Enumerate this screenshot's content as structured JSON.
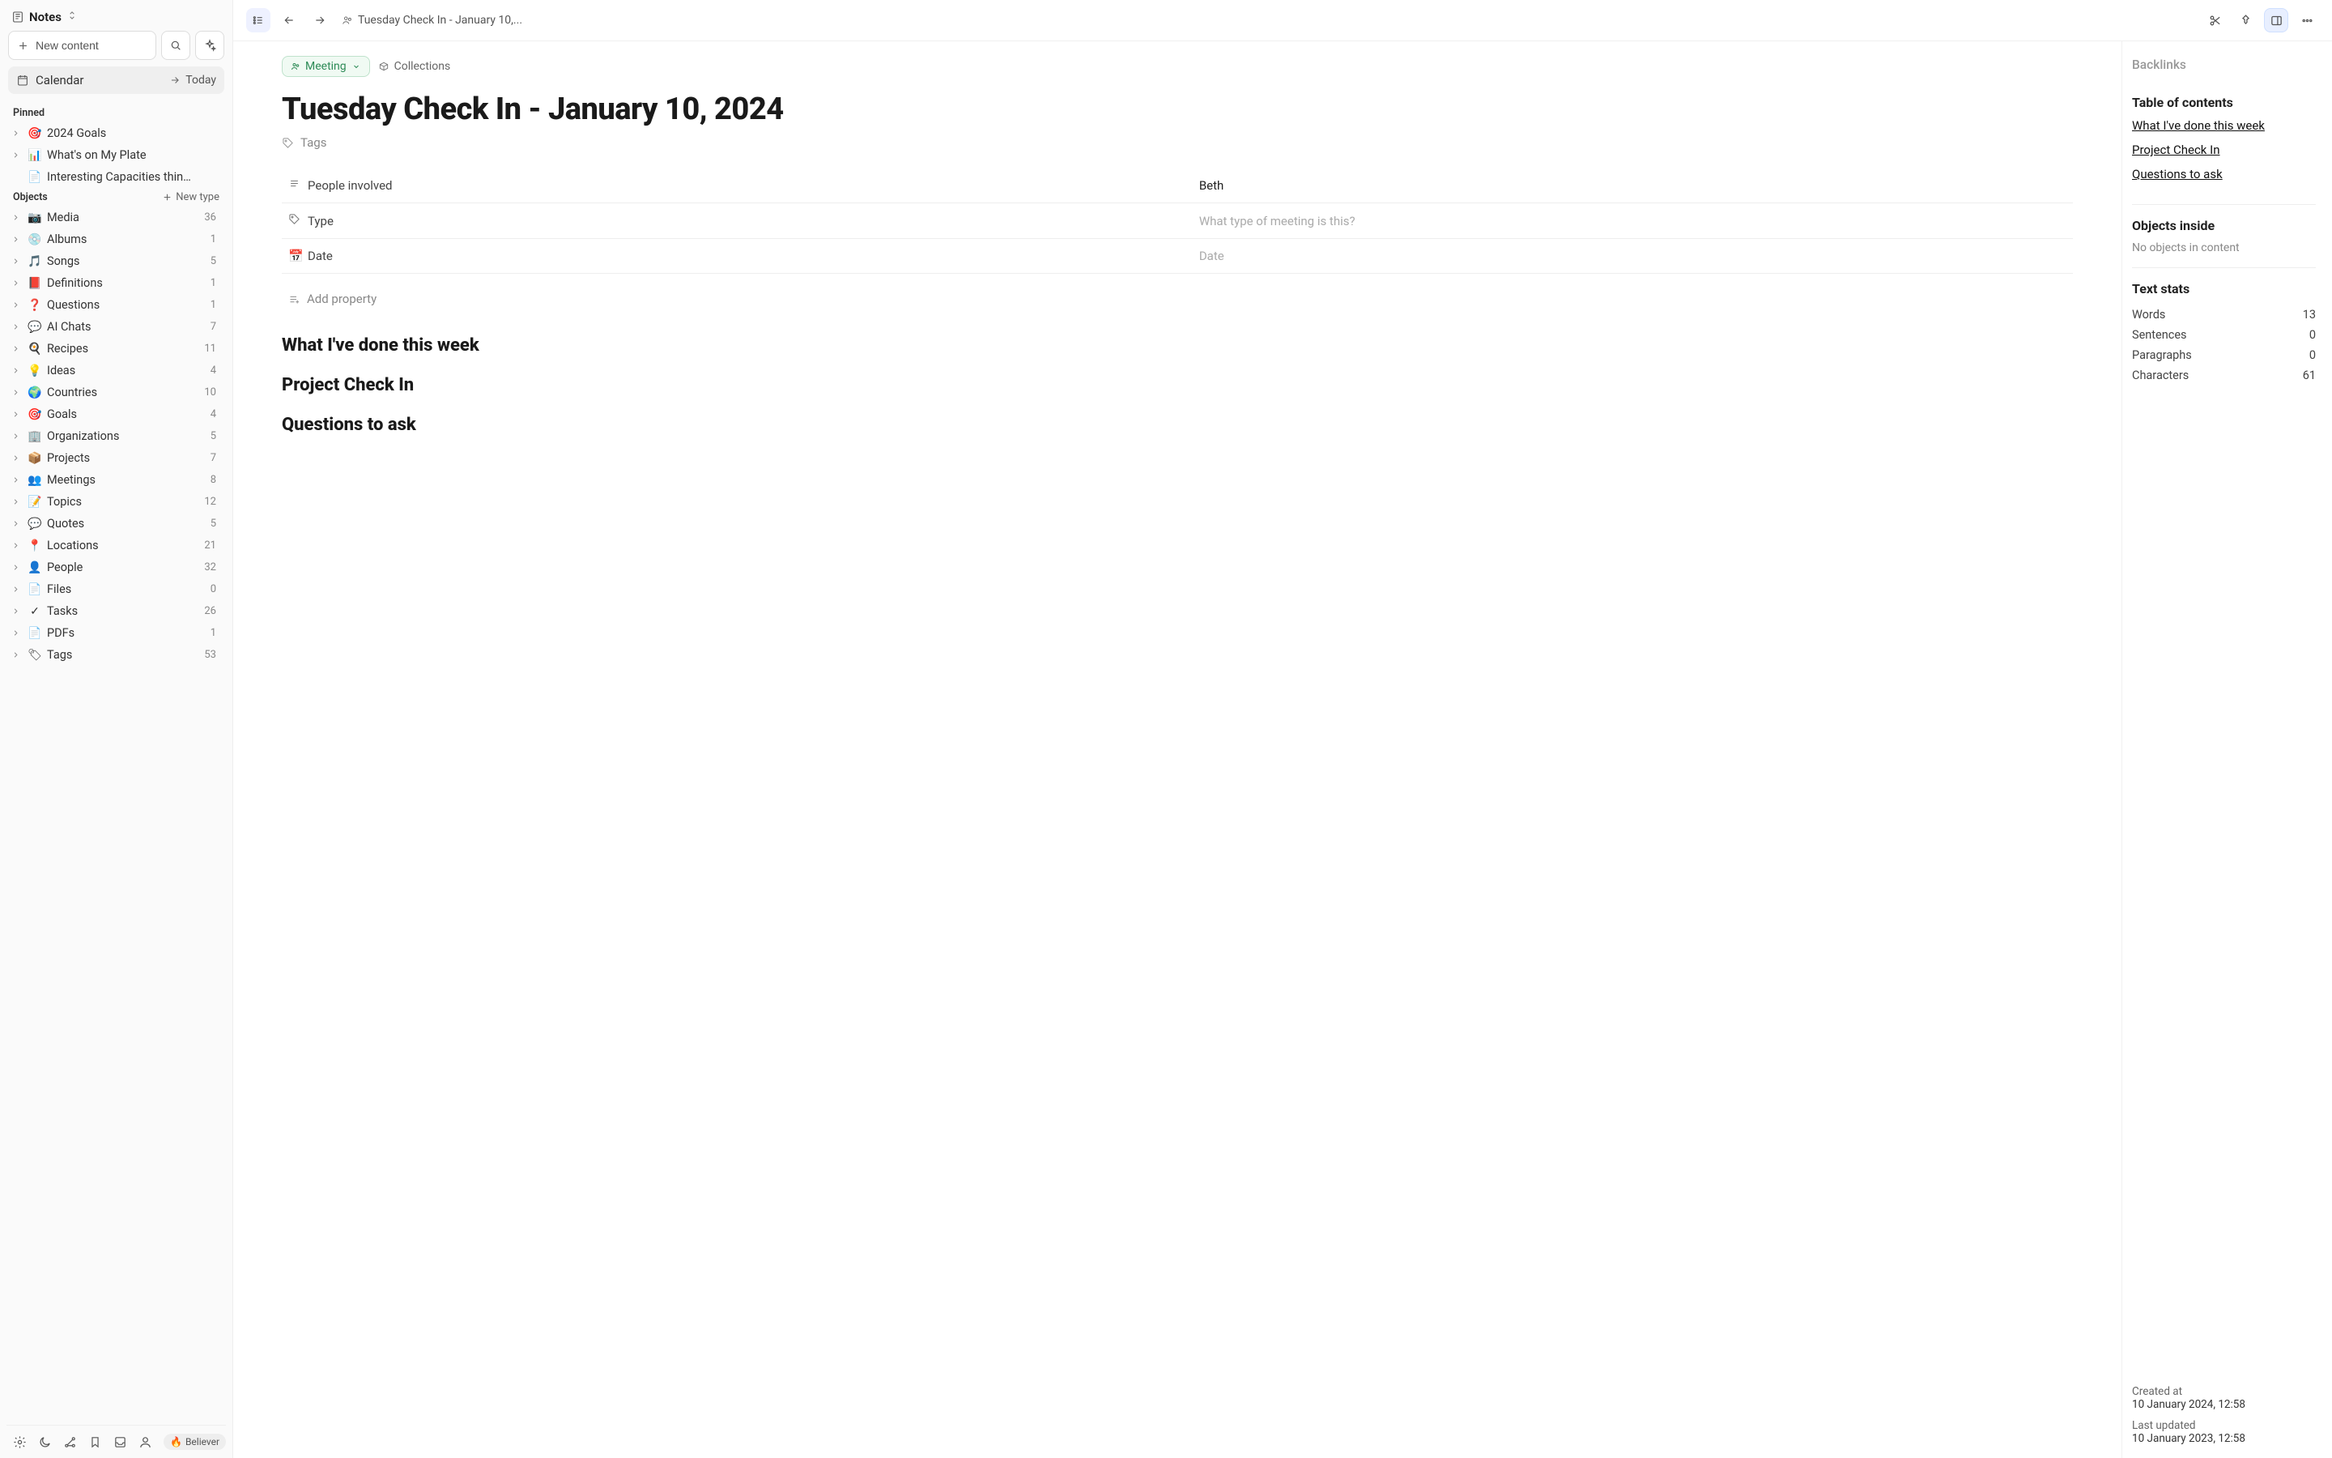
{
  "sidebar": {
    "title": "Notes",
    "new_content": "New content",
    "calendar": {
      "label": "Calendar",
      "today": "Today"
    },
    "pinned_label": "Pinned",
    "pinned": [
      {
        "icon": "🎯",
        "label": "2024 Goals",
        "chev": true
      },
      {
        "icon": "📊",
        "label": "What's on My Plate",
        "chev": true
      },
      {
        "icon": "📄",
        "label": "Interesting Capacities thin…",
        "chev": false
      }
    ],
    "objects_label": "Objects",
    "new_type": "New type",
    "objects": [
      {
        "icon": "📷",
        "label": "Media",
        "count": "36"
      },
      {
        "icon": "💿",
        "label": "Albums",
        "count": "1"
      },
      {
        "icon": "🎵",
        "label": "Songs",
        "count": "5"
      },
      {
        "icon": "📕",
        "label": "Definitions",
        "count": "1"
      },
      {
        "icon": "❓",
        "label": "Questions",
        "count": "1"
      },
      {
        "icon": "💬",
        "label": "AI Chats",
        "count": "7"
      },
      {
        "icon": "🍳",
        "label": "Recipes",
        "count": "11"
      },
      {
        "icon": "💡",
        "label": "Ideas",
        "count": "4"
      },
      {
        "icon": "🌍",
        "label": "Countries",
        "count": "10"
      },
      {
        "icon": "🎯",
        "label": "Goals",
        "count": "4"
      },
      {
        "icon": "🏢",
        "label": "Organizations",
        "count": "5"
      },
      {
        "icon": "📦",
        "label": "Projects",
        "count": "7"
      },
      {
        "icon": "👥",
        "label": "Meetings",
        "count": "8"
      },
      {
        "icon": "📝",
        "label": "Topics",
        "count": "12"
      },
      {
        "icon": "💬",
        "label": "Quotes",
        "count": "5"
      },
      {
        "icon": "📍",
        "label": "Locations",
        "count": "21"
      },
      {
        "icon": "👤",
        "label": "People",
        "count": "32"
      },
      {
        "icon": "📄",
        "label": "Files",
        "count": "0"
      },
      {
        "icon": "✓",
        "label": "Tasks",
        "count": "26"
      },
      {
        "icon": "📄",
        "label": "PDFs",
        "count": "1"
      },
      {
        "icon": "🏷",
        "label": "Tags",
        "count": "53"
      }
    ],
    "believer": "Believer"
  },
  "topbar": {
    "breadcrumb": "Tuesday Check In - January 10,..."
  },
  "doc": {
    "meeting_pill": "Meeting",
    "collections": "Collections",
    "title": "Tuesday Check In - January 10, 2024",
    "tags_label": "Tags",
    "properties": [
      {
        "icon": "text",
        "key": "People involved",
        "value": "Beth",
        "placeholder": ""
      },
      {
        "icon": "tag",
        "key": "Type",
        "value": "",
        "placeholder": "What type of meeting is this?"
      },
      {
        "icon": "📅",
        "key": "Date",
        "value": "",
        "placeholder": "Date"
      }
    ],
    "add_property": "Add property",
    "headings": [
      "What I've done this week",
      "Project Check In",
      "Questions to ask"
    ]
  },
  "rpanel": {
    "backlinks": "Backlinks",
    "toc_title": "Table of contents",
    "toc": [
      "What I've done this week",
      "Project Check In",
      "Questions to ask"
    ],
    "objects_inside_title": "Objects inside",
    "objects_inside_empty": "No objects in content",
    "text_stats_title": "Text stats",
    "stats": [
      {
        "label": "Words",
        "value": "13"
      },
      {
        "label": "Sentences",
        "value": "0"
      },
      {
        "label": "Paragraphs",
        "value": "0"
      },
      {
        "label": "Characters",
        "value": "61"
      }
    ],
    "created_label": "Created at",
    "created_value": "10 January 2024, 12:58",
    "updated_label": "Last updated",
    "updated_value": "10 January 2023, 12:58"
  }
}
